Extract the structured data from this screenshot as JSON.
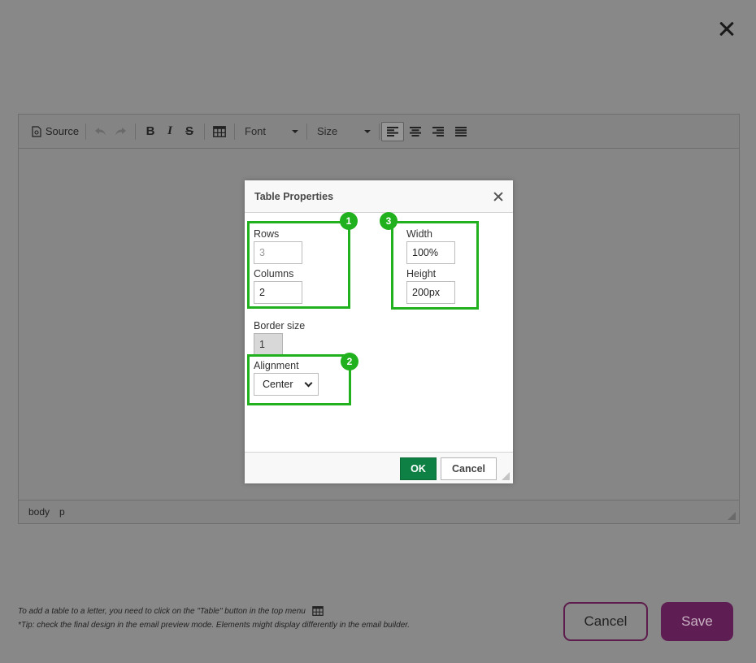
{
  "modal": {
    "close_icon": "close-icon"
  },
  "toolbar": {
    "source_label": "Source",
    "font_label": "Font",
    "size_label": "Size",
    "icons": [
      "source-icon",
      "undo-icon",
      "redo-icon",
      "bold-icon",
      "italic-icon",
      "strikethrough-icon",
      "table-icon",
      "align-left-icon",
      "align-center-icon",
      "align-right-icon",
      "justify-icon"
    ],
    "bold_glyph": "B",
    "italic_glyph": "I",
    "strike_glyph": "S"
  },
  "statusbar": {
    "path": [
      "body",
      "p"
    ]
  },
  "dialog": {
    "title": "Table Properties",
    "rows_label": "Rows",
    "rows_value": "3",
    "columns_label": "Columns",
    "columns_value": "2",
    "width_label": "Width",
    "width_value": "100%",
    "height_label": "Height",
    "height_value": "200px",
    "border_label": "Border size",
    "border_value": "1",
    "alignment_label": "Alignment",
    "alignment_value": "Center",
    "ok_label": "OK",
    "cancel_label": "Cancel",
    "badges": [
      "1",
      "2",
      "3"
    ],
    "highlight_color": "#22b11e"
  },
  "footer": {
    "hint_line1": "To add a table to a letter, you need to click on the \"Table\" button in the top menu",
    "hint_line2": "*Tip: check the final design in the email preview mode. Elements might display differently in the email builder.",
    "cancel_label": "Cancel",
    "save_label": "Save",
    "save_color": "#5e1d53"
  }
}
